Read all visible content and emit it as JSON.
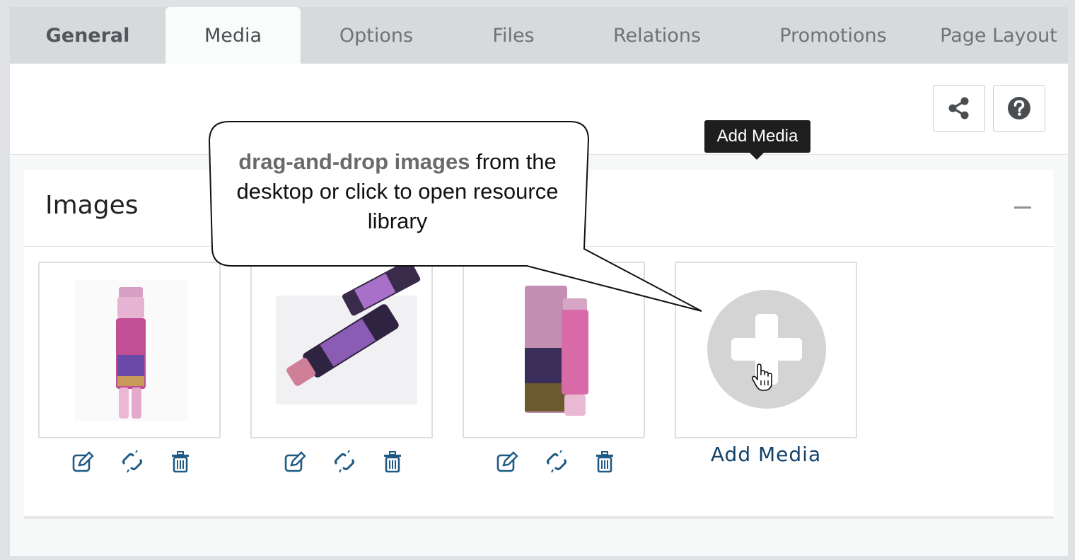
{
  "tabs": [
    {
      "label": "General",
      "active": false
    },
    {
      "label": "Media",
      "active": true
    },
    {
      "label": "Options",
      "active": false
    },
    {
      "label": "Files",
      "active": false
    },
    {
      "label": "Relations",
      "active": false
    },
    {
      "label": "Promotions",
      "active": false
    },
    {
      "label": "Page Layout",
      "active": false
    }
  ],
  "toolbar": {
    "share_icon": "share-icon",
    "help_icon": "question-circle-icon"
  },
  "images_section": {
    "title": "Images",
    "items": [
      {
        "name": "product-image-1",
        "actions": [
          "edit-icon",
          "unlink-icon",
          "trash-icon"
        ]
      },
      {
        "name": "product-image-2",
        "actions": [
          "edit-icon",
          "unlink-icon",
          "trash-icon"
        ]
      },
      {
        "name": "product-image-3",
        "actions": [
          "edit-icon",
          "unlink-icon",
          "trash-icon"
        ]
      }
    ],
    "add_media_label": "Add Media",
    "tooltip": "Add Media"
  },
  "callout": {
    "highlight": "drag-and-drop images",
    "text": " from the desktop or click to open resource library"
  },
  "colors": {
    "accent": "#12426b",
    "tab_active_bg": "#fafbfb",
    "tooltip_bg": "#1e1e1e"
  }
}
